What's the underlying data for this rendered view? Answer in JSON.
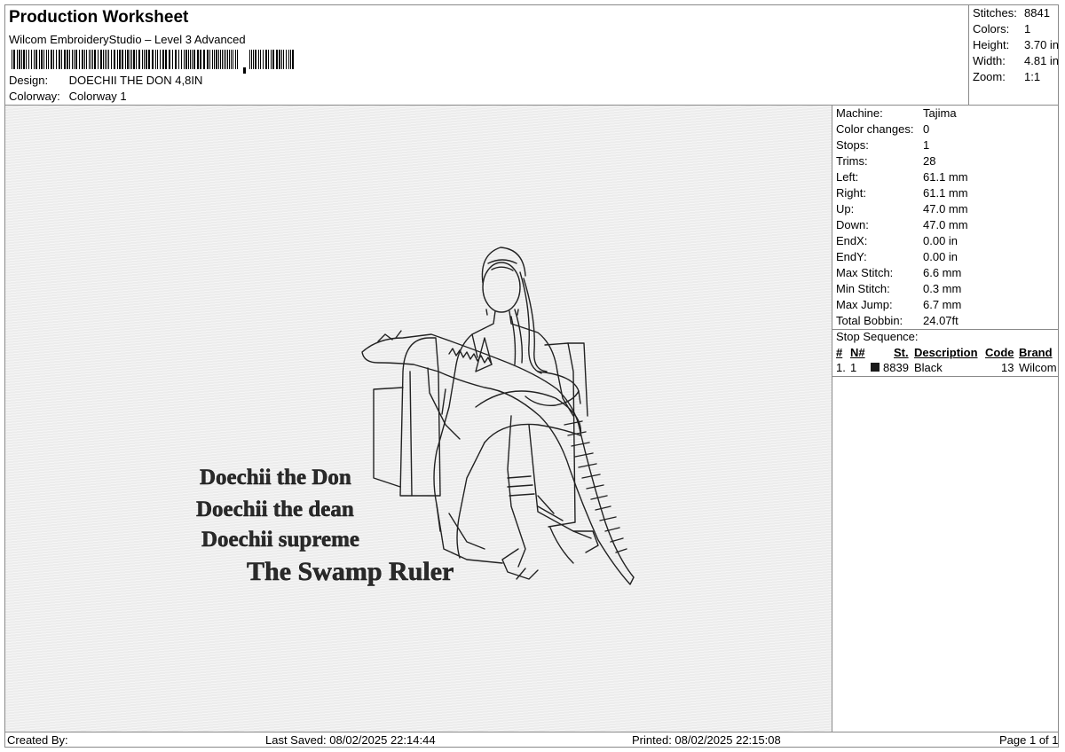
{
  "header": {
    "title": "Production Worksheet",
    "subtitle": "Wilcom EmbroideryStudio – Level 3 Advanced",
    "design_label": "Design:",
    "design_value": "DOECHII THE DON 4,8IN",
    "colorway_label": "Colorway:",
    "colorway_value": "Colorway 1"
  },
  "summary": [
    {
      "label": "Stitches:",
      "value": "8841"
    },
    {
      "label": "Colors:",
      "value": "1"
    },
    {
      "label": "Height:",
      "value": "3.70 in"
    },
    {
      "label": "Width:",
      "value": "4.81 in"
    },
    {
      "label": "Zoom:",
      "value": "1:1"
    }
  ],
  "machine": [
    {
      "label": "Machine:",
      "value": "Tajima"
    },
    {
      "label": "Color changes:",
      "value": "0"
    },
    {
      "label": "Stops:",
      "value": "1"
    },
    {
      "label": "Trims:",
      "value": "28"
    },
    {
      "label": "Left:",
      "value": "61.1 mm"
    },
    {
      "label": "Right:",
      "value": "61.1 mm"
    },
    {
      "label": "Up:",
      "value": "47.0 mm"
    },
    {
      "label": "Down:",
      "value": "47.0 mm"
    },
    {
      "label": "EndX:",
      "value": "0.00 in"
    },
    {
      "label": "EndY:",
      "value": "0.00 in"
    },
    {
      "label": "Max Stitch:",
      "value": "6.6 mm"
    },
    {
      "label": "Min Stitch:",
      "value": "0.3 mm"
    },
    {
      "label": "Max Jump:",
      "value": "6.7 mm"
    },
    {
      "label": "Total Bobbin:",
      "value": "24.07ft"
    }
  ],
  "stop_sequence": {
    "title": "Stop Sequence:",
    "headers": [
      "#",
      "N#",
      "St.",
      "Description",
      "Code",
      "Brand"
    ],
    "rows": [
      {
        "num": "1.",
        "n": "1",
        "stitches": "8839",
        "description": "Black",
        "code": "13",
        "brand": "Wilcom",
        "color": "#1a1a1a"
      }
    ]
  },
  "design_text": {
    "line1": "Doechii the Don",
    "line2": "Doechii the dean",
    "line3": "Doechii supreme",
    "line4": "The Swamp Ruler"
  },
  "footer": {
    "created_by": "Created By:",
    "last_saved": "Last Saved: 08/02/2025 22:14:44",
    "printed": "Printed: 08/02/2025 22:15:08",
    "page": "Page 1 of 1"
  }
}
